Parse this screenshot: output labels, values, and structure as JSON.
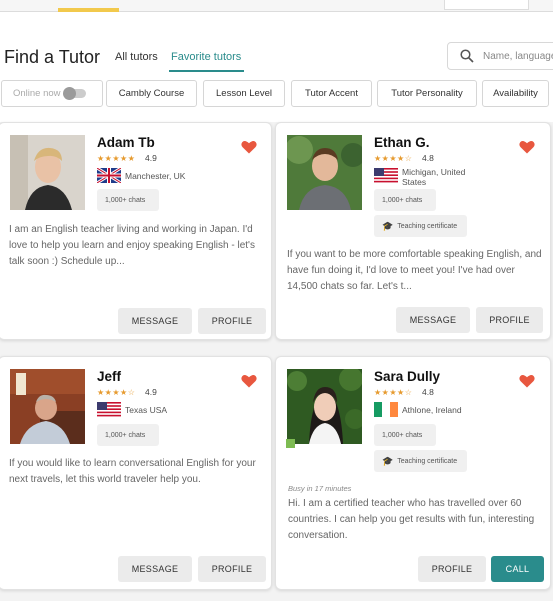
{
  "header": {
    "title": "Find a Tutor",
    "tabs": [
      "All tutors",
      "Favorite tutors"
    ],
    "search_placeholder": "Name, language"
  },
  "filters": {
    "online_now": "Online now",
    "items": [
      "Cambly Course",
      "Lesson Level",
      "Tutor Accent",
      "Tutor Personality",
      "Availability"
    ]
  },
  "colors": {
    "accent_teal": "#2a8c8c",
    "star": "#e69a2e",
    "heart": "#e8573f",
    "online": "#7dbb52"
  },
  "tutors": [
    {
      "name": "Adam Tb",
      "stars": "★★★★★",
      "rating": "4.9",
      "flag": "uk",
      "location": "Manchester, UK",
      "chats": "1,000+ chats",
      "description": "I am an English teacher living and working in Japan. I'd love to help you learn and enjoy speaking English - let's talk soon :) Schedule up...",
      "buttons": [
        "MESSAGE",
        "PROFILE"
      ]
    },
    {
      "name": "Ethan G.",
      "stars": "★★★★☆",
      "rating": "4.8",
      "flag": "usa",
      "location": "Michigan, United States",
      "chats": "1,000+ chats",
      "certificate": "Teaching certificate",
      "description": "If you want to be more comfortable speaking English, and have fun doing it, I'd love to meet you! I've had over 14,500 chats so far. Let's t...",
      "buttons": [
        "MESSAGE",
        "PROFILE"
      ]
    },
    {
      "name": "Jeff",
      "stars": "★★★★☆",
      "rating": "4.9",
      "flag": "usa",
      "location": "Texas USA",
      "chats": "1,000+ chats",
      "description": "If you would like to learn conversational English for your next travels, let this world traveler help you.",
      "buttons": [
        "MESSAGE",
        "PROFILE"
      ]
    },
    {
      "name": "Sara Dully",
      "stars": "★★★★☆",
      "rating": "4.8",
      "flag": "ireland",
      "location": "Athlone, Ireland",
      "chats": "1,000+ chats",
      "certificate": "Teaching certificate",
      "busy": "Busy in 17 minutes",
      "description": "Hi. I am a certified teacher who has travelled over 60 countries. I can help you get results with fun, interesting conversation.",
      "buttons": [
        "PROFILE",
        "CALL"
      ]
    }
  ]
}
